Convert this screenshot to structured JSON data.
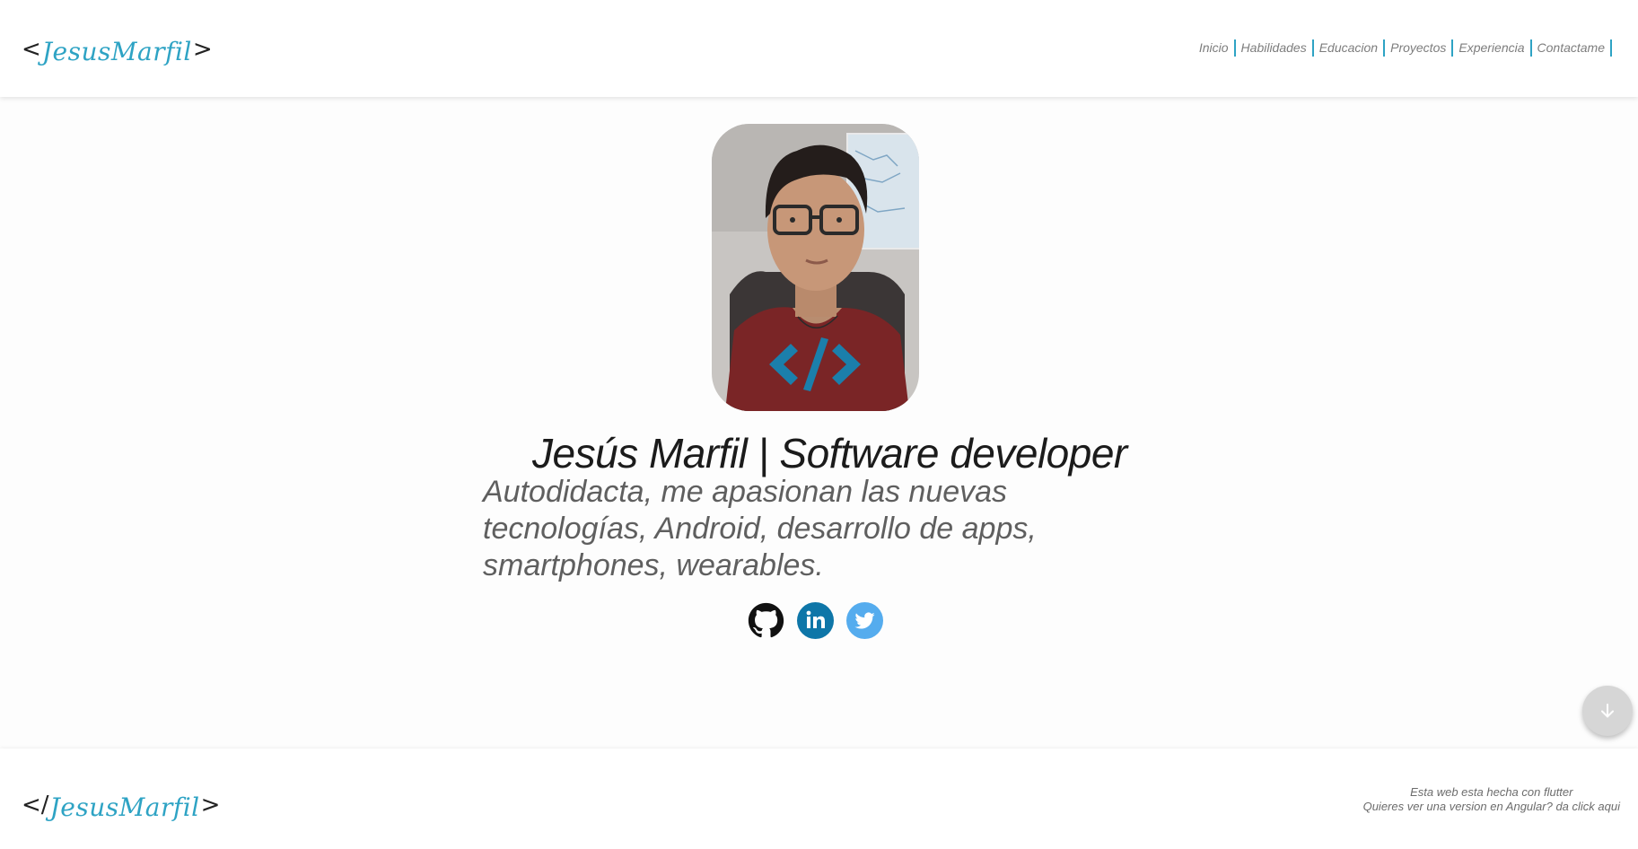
{
  "header": {
    "logo": {
      "open": "<",
      "name": "JesusMarfil",
      "close": ">"
    },
    "nav": [
      {
        "label": "Inicio"
      },
      {
        "label": "Habilidades"
      },
      {
        "label": "Educacion"
      },
      {
        "label": "Proyectos"
      },
      {
        "label": "Experiencia"
      },
      {
        "label": "Contactame"
      }
    ]
  },
  "hero": {
    "photo_icon": "profile-photo",
    "title": "Jesús Marfil | Software developer",
    "subtitle": "Autodidacta, me apasionan las nuevas tecnologías, Android, desarrollo de apps, smartphones, wearables."
  },
  "social": [
    {
      "icon": "github-icon",
      "color": "#111111"
    },
    {
      "icon": "linkedin-icon",
      "color": "#0e76a8"
    },
    {
      "icon": "twitter-icon",
      "color": "#55acee"
    }
  ],
  "scroll_button": {
    "icon": "arrow-down-icon"
  },
  "footer": {
    "logo": {
      "open": "</",
      "name": "JesusMarfil",
      "close": ">"
    },
    "line1": "Esta web esta hecha con flutter",
    "line2": "Quieres ver una version en Angular? da click aqui"
  },
  "colors": {
    "accent": "#2ea3c4",
    "nav_text": "#7d7d7d",
    "background": "#ffffff"
  }
}
